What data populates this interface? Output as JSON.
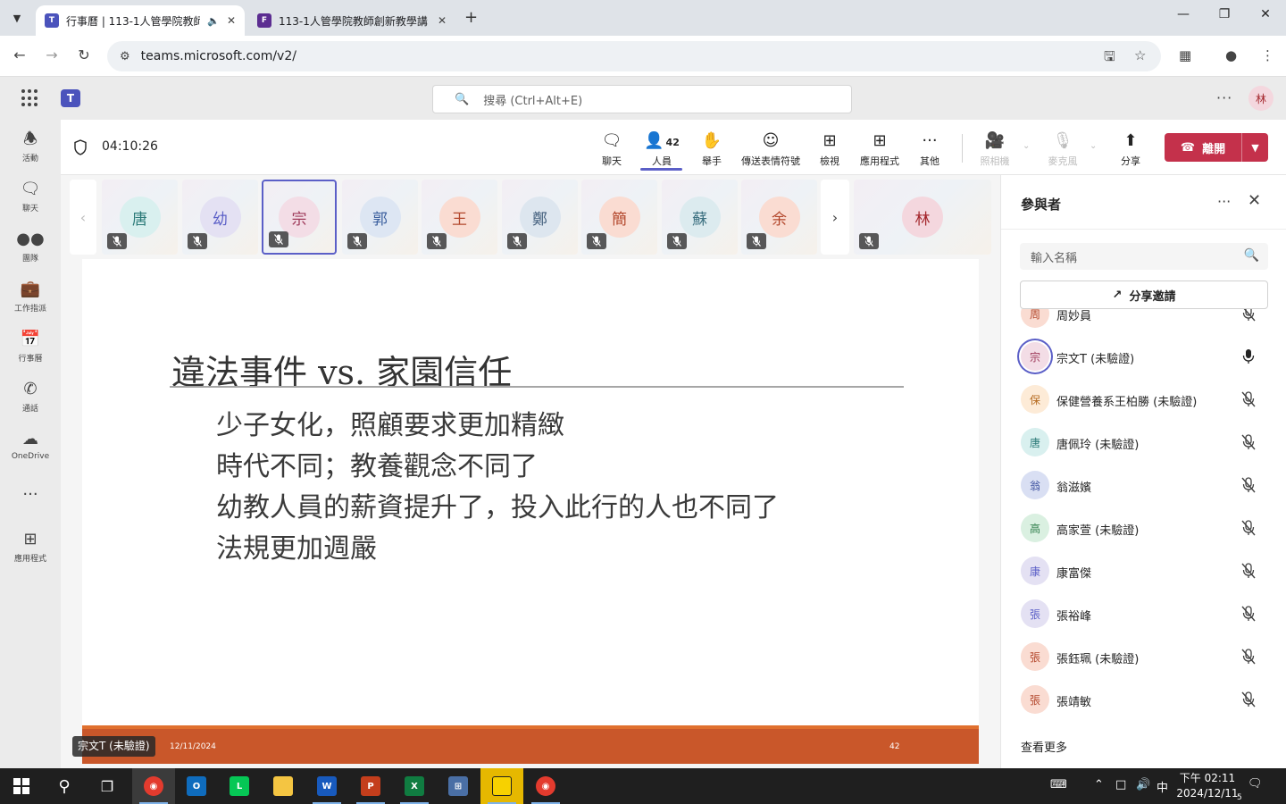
{
  "browser": {
    "tabs": [
      {
        "title": "行事曆 | 113-1人管學院教師",
        "favicon_color": "#4b53bc"
      },
      {
        "title": "113-1人管學院教師創新教學講",
        "favicon_color": "#5c2d91"
      }
    ],
    "url": "teams.microsoft.com/v2/"
  },
  "teams": {
    "search_placeholder": "搜尋 (Ctrl+Alt+E)",
    "me_initial": "林"
  },
  "rail": [
    {
      "label": "活動",
      "icon": "bell-icon"
    },
    {
      "label": "聊天",
      "icon": "chat-icon"
    },
    {
      "label": "團隊",
      "icon": "teams-icon"
    },
    {
      "label": "工作指派",
      "icon": "assignments-icon"
    },
    {
      "label": "行事曆",
      "icon": "calendar-icon"
    },
    {
      "label": "通話",
      "icon": "phone-icon"
    },
    {
      "label": "OneDrive",
      "icon": "cloud-icon"
    },
    {
      "label": "應用程式",
      "icon": "apps-icon"
    }
  ],
  "meeting": {
    "timer": "04:10:26",
    "toolbar": {
      "chat": "聊天",
      "people": "人員",
      "people_count": "42",
      "raise_hand": "舉手",
      "react": "傳送表情符號",
      "view": "檢視",
      "apps": "應用程式",
      "more": "其他",
      "camera": "照相機",
      "mic": "麥克風",
      "share": "分享",
      "leave": "離開"
    },
    "gallery": [
      {
        "initial": "唐",
        "bg": "#d9f0ef",
        "fg": "#2b7a78"
      },
      {
        "initial": "幼",
        "bg": "#e4e1f3",
        "fg": "#5b5fc7"
      },
      {
        "initial": "宗",
        "bg": "#f3dde6",
        "fg": "#9e3a5a",
        "selected": true
      },
      {
        "initial": "郭",
        "bg": "#dde6f3",
        "fg": "#3b5f9e"
      },
      {
        "initial": "王",
        "bg": "#fadcd2",
        "fg": "#b3472c"
      },
      {
        "initial": "鄭",
        "bg": "#dde6ef",
        "fg": "#44607e"
      },
      {
        "initial": "簡",
        "bg": "#fadcd2",
        "fg": "#b3472c"
      },
      {
        "initial": "蘇",
        "bg": "#dcebef",
        "fg": "#3e7282"
      },
      {
        "initial": "余",
        "bg": "#fadcd2",
        "fg": "#b3472c"
      },
      {
        "initial": "林",
        "bg": "#f4d7de",
        "fg": "#a4262c"
      }
    ],
    "presenter_label": "宗文T (未驗證)"
  },
  "slide": {
    "title": "違法事件 vs. 家園信任",
    "bullets": [
      "少子女化，照顧要求更加精緻",
      "時代不同；教養觀念不同了",
      "幼教人員的薪資提升了，投入此行的人也不同了",
      "法規更加週嚴"
    ],
    "footer_date": "12/11/2024",
    "footer_page": "42"
  },
  "participants_panel": {
    "title": "參與者",
    "search_placeholder": "輸入名稱",
    "share_invite": "分享邀請",
    "list": [
      {
        "initial": "周",
        "name": "周妙員",
        "bg": "#fadcd2",
        "fg": "#b3472c",
        "mic": "muted"
      },
      {
        "initial": "宗",
        "name": "宗文T (未驗證)",
        "bg": "#f3dde6",
        "fg": "#9e3a5a",
        "mic": "on",
        "speaking": true
      },
      {
        "initial": "保",
        "name": "保健營養系王柏勝 (未驗證)",
        "bg": "#fdebd7",
        "fg": "#b56a1f",
        "mic": "muted"
      },
      {
        "initial": "唐",
        "name": "唐佩玲 (未驗證)",
        "bg": "#d9f0ef",
        "fg": "#2b7a78",
        "mic": "muted"
      },
      {
        "initial": "翁",
        "name": "翁滋嬪",
        "bg": "#d9dff3",
        "fg": "#3b4f9e",
        "mic": "muted"
      },
      {
        "initial": "高",
        "name": "高家萱 (未驗證)",
        "bg": "#daf0e1",
        "fg": "#2e7d4a",
        "mic": "muted"
      },
      {
        "initial": "康",
        "name": "康富傑",
        "bg": "#e4e1f3",
        "fg": "#5b5fc7",
        "mic": "muted"
      },
      {
        "initial": "張",
        "name": "張裕峰",
        "bg": "#e4e1f3",
        "fg": "#5b5fc7",
        "mic": "muted"
      },
      {
        "initial": "張",
        "name": "張鈺珮 (未驗證)",
        "bg": "#fadcd2",
        "fg": "#b3472c",
        "mic": "muted"
      },
      {
        "initial": "張",
        "name": "張靖敏",
        "bg": "#fadcd2",
        "fg": "#b3472c",
        "mic": "muted"
      }
    ],
    "see_more": "查看更多"
  },
  "taskbar": {
    "clock_time": "下午 02:11",
    "clock_date": "2024/12/11",
    "ime": "中",
    "notifications": "5"
  }
}
